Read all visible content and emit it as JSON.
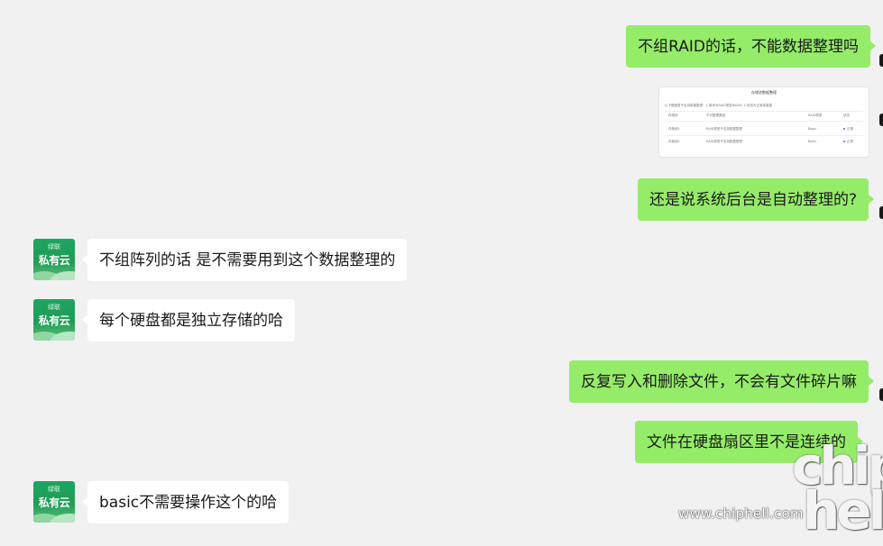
{
  "messages": [
    {
      "side": "right",
      "text": "不组RAID的话，不能数据整理吗"
    },
    {
      "side": "right",
      "type": "image"
    },
    {
      "side": "right",
      "text": "还是说系统后台是自动整理的?"
    },
    {
      "side": "left",
      "text": "不组阵列的话 是不需要用到这个数据整理的"
    },
    {
      "side": "left",
      "text": "每个硬盘都是独立存储的哈"
    },
    {
      "side": "right",
      "text": "反复写入和删除文件，不会有文件碎片嘛"
    },
    {
      "side": "right",
      "text": "文件在硬盘扇区里不是连续的"
    },
    {
      "side": "left",
      "text": "basic不需要操作这个的哈"
    }
  ],
  "contact_avatar": {
    "small_text": "绿联",
    "main_text": "私有云"
  },
  "screenshot_image": {
    "title": "存储池数据整理",
    "desc": "以下硬盘暂不支持数据整理：1.单块为RAID类型RAID0; 2.状态为正常或重建",
    "headers": [
      "存储池",
      "不可整理原因",
      "RAID类型",
      "状态"
    ],
    "rows": [
      [
        "存储池1",
        "RAID类型不支持数据整理",
        "Basic",
        "正常"
      ],
      [
        "存储池2",
        "RAID类型不支持数据整理",
        "Basic",
        "正常"
      ]
    ]
  },
  "watermark": {
    "url": "www.chiphell.com",
    "logo_line1": "chip",
    "logo_line2": "hell"
  },
  "colors": {
    "self_bubble": "#95ec69",
    "other_bubble": "#ffffff",
    "background": "#f1f1f1"
  }
}
